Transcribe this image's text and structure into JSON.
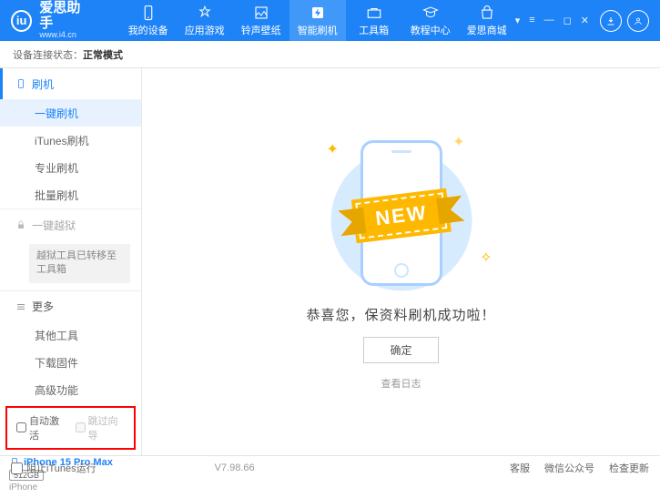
{
  "brand": {
    "name": "爱思助手",
    "url": "www.i4.cn"
  },
  "nav": {
    "items": [
      {
        "label": "我的设备"
      },
      {
        "label": "应用游戏"
      },
      {
        "label": "铃声壁纸"
      },
      {
        "label": "智能刷机"
      },
      {
        "label": "工具箱"
      },
      {
        "label": "教程中心"
      },
      {
        "label": "爱思商城"
      }
    ],
    "active_index": 3
  },
  "status": {
    "label": "设备连接状态：",
    "value": "正常模式"
  },
  "sidebar": {
    "flash": {
      "title": "刷机",
      "items": [
        "一键刷机",
        "iTunes刷机",
        "专业刷机",
        "批量刷机"
      ],
      "active_index": 0
    },
    "jailbreak": {
      "title": "一键越狱",
      "note": "越狱工具已转移至工具箱"
    },
    "more": {
      "title": "更多",
      "items": [
        "其他工具",
        "下载固件",
        "高级功能"
      ]
    },
    "checkboxes": {
      "auto_activate": "自动激活",
      "skip_guide": "跳过向导"
    },
    "device": {
      "name": "iPhone 15 Pro Max",
      "storage": "512GB",
      "type": "iPhone"
    }
  },
  "content": {
    "ribbon": "NEW",
    "success_text": "恭喜您，保资料刷机成功啦！",
    "ok_button": "确定",
    "log_link": "查看日志"
  },
  "footer": {
    "block_itunes": "阻止iTunes运行",
    "version": "V7.98.66",
    "links": [
      "客服",
      "微信公众号",
      "检查更新"
    ]
  }
}
